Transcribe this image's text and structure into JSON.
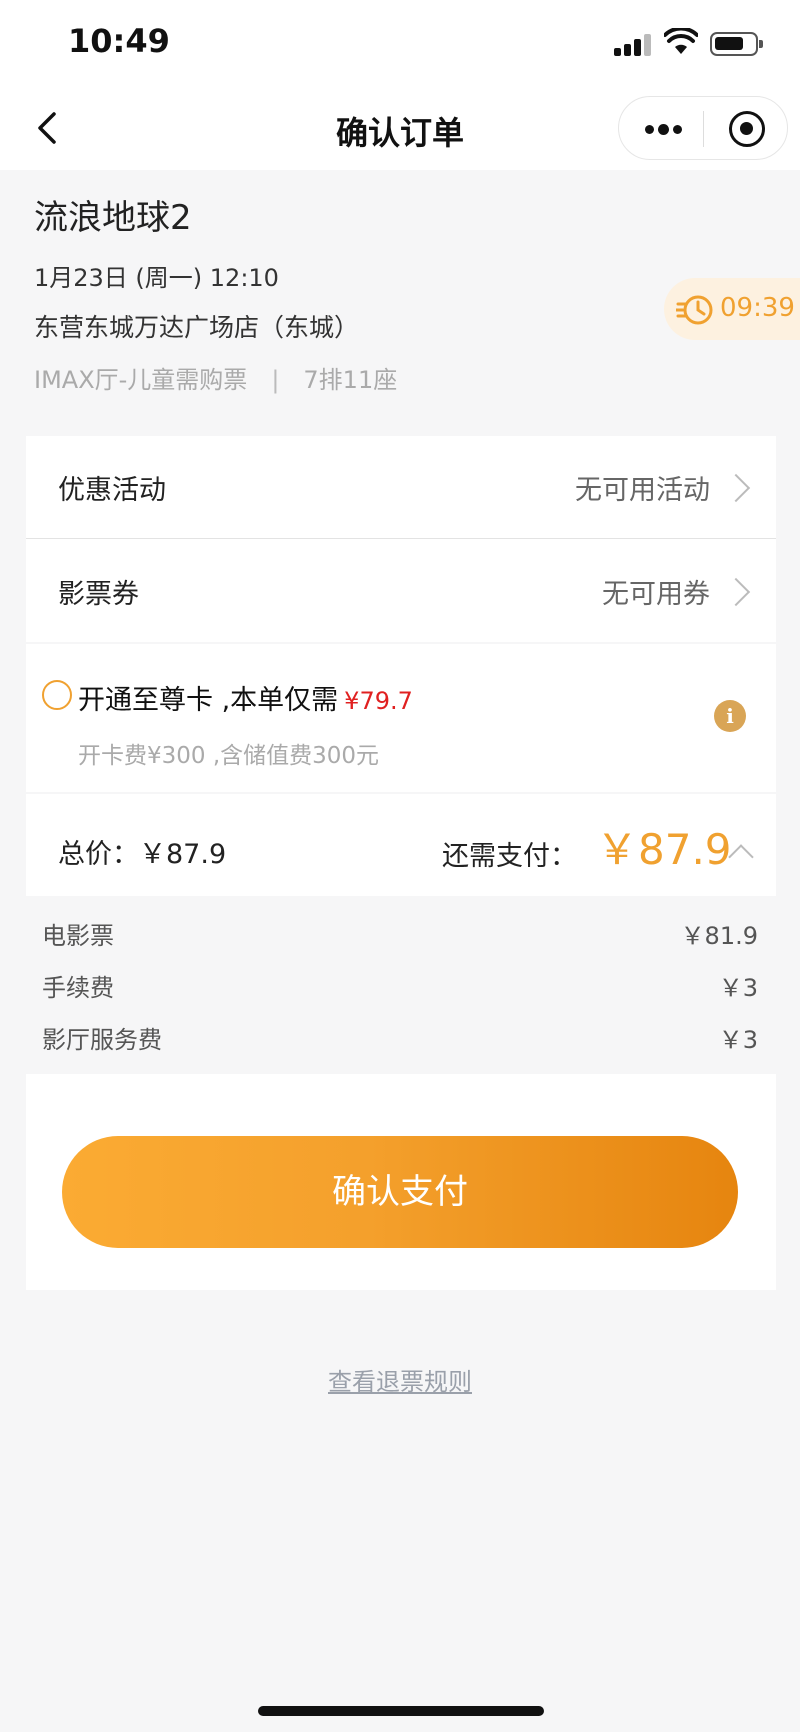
{
  "status_bar": {
    "time": "10:49"
  },
  "nav": {
    "title": "确认订单"
  },
  "movie": {
    "title": "流浪地球2",
    "showtime": "1月23日 (周一) 12:10",
    "cinema": "东营东城万达广场店（东城）",
    "hall": "IMAX厅-儿童需购票",
    "separator": "|",
    "seat": "7排11座"
  },
  "countdown": "09:39",
  "promotions": {
    "label": "优惠活动",
    "value": "无可用活动"
  },
  "coupons": {
    "label": "影票券",
    "value": "无可用券"
  },
  "vip_card": {
    "text": "开通至尊卡 ,本单仅需",
    "price": "¥79.7",
    "subtext": "开卡费¥300 ,含储值费300元"
  },
  "summary": {
    "total_label": "总价：￥87.9",
    "need_pay_label": "还需支付：",
    "need_pay_amount": "￥87.9"
  },
  "breakdown": [
    {
      "label": "电影票",
      "value": "￥81.9"
    },
    {
      "label": "手续费",
      "value": "￥3"
    },
    {
      "label": "影厅服务费",
      "value": "￥3"
    }
  ],
  "pay_button": "确认支付",
  "refund_link": "查看退票规则",
  "colors": {
    "accent": "#f0a130",
    "price_red": "#e02020",
    "background": "#f6f6f7"
  }
}
